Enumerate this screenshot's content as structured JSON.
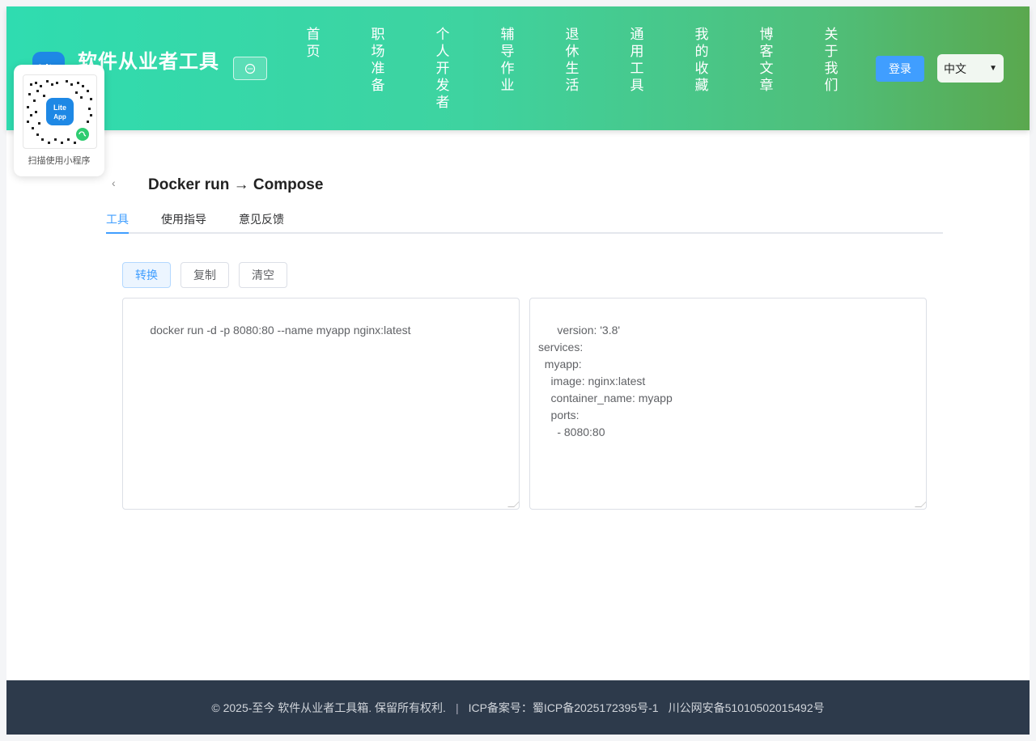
{
  "header": {
    "logo_text": "Lite",
    "site_title": "软件从业者工具",
    "chat_icon": "chat-bubble-icon",
    "nav": [
      {
        "label": "首页"
      },
      {
        "label": "职场准备"
      },
      {
        "label": "个人开发者"
      },
      {
        "label": "辅导作业"
      },
      {
        "label": "退休生活"
      },
      {
        "label": "通用工具"
      },
      {
        "label": "我的收藏"
      },
      {
        "label": "博客文章"
      },
      {
        "label": "关于我们"
      }
    ],
    "login_label": "登录",
    "language": "中文"
  },
  "qr_popup": {
    "badge": "Lite App",
    "caption": "扫描使用小程序"
  },
  "page": {
    "title": "Docker run → Compose",
    "tabs": [
      {
        "label": "工具",
        "active": true
      },
      {
        "label": "使用指导",
        "active": false
      },
      {
        "label": "意见反馈",
        "active": false
      }
    ],
    "buttons": {
      "convert": "转换",
      "copy": "复制",
      "clear": "清空"
    },
    "input_value": "docker run -d -p 8080:80 --name myapp nginx:latest",
    "output_value": "version: '3.8'\nservices:\n  myapp:\n    image: nginx:latest\n    container_name: myapp\n    ports:\n      - 8080:80"
  },
  "footer": {
    "copyright": "© 2025-至今 软件从业者工具箱. 保留所有权利.",
    "separator": "|",
    "icp": "ICP备案号：蜀ICP备2025172395号-1",
    "police": "川公网安备51010502015492号"
  },
  "colors": {
    "accent": "#409eff",
    "header_start": "#2fdcb0",
    "header_end": "#5aa84e",
    "footer_bg": "#2d3a4b"
  }
}
